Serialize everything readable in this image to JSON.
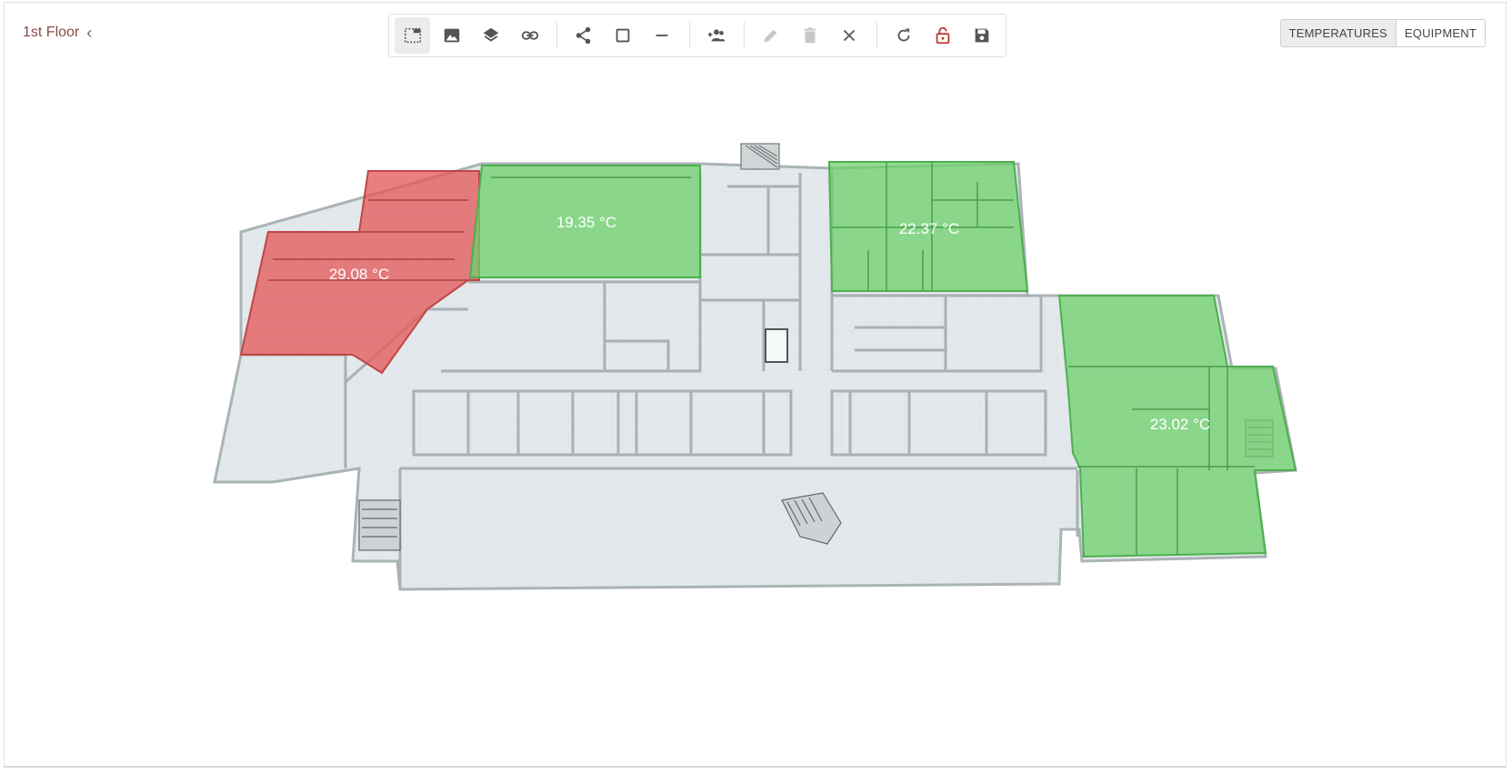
{
  "floor": {
    "title": "1st Floor",
    "back_icon": "chevron-left-icon"
  },
  "toolbar": {
    "buttons": [
      {
        "icon": "select-area-icon",
        "active": true,
        "enabled": true
      },
      {
        "icon": "image-icon",
        "active": false,
        "enabled": true
      },
      {
        "icon": "layers-icon",
        "active": false,
        "enabled": true
      },
      {
        "icon": "link-icon",
        "active": false,
        "enabled": true
      },
      {
        "icon": "share-icon",
        "active": false,
        "enabled": true
      },
      {
        "icon": "square-icon",
        "active": false,
        "enabled": true
      },
      {
        "icon": "line-icon",
        "active": false,
        "enabled": true
      },
      {
        "icon": "add-group-icon",
        "active": false,
        "enabled": true
      },
      {
        "icon": "edit-icon",
        "active": false,
        "enabled": false
      },
      {
        "icon": "delete-icon",
        "active": false,
        "enabled": false
      },
      {
        "icon": "close-icon",
        "active": false,
        "enabled": true
      },
      {
        "icon": "refresh-icon",
        "active": false,
        "enabled": true
      },
      {
        "icon": "unlock-icon",
        "active": false,
        "enabled": true
      },
      {
        "icon": "save-icon",
        "active": false,
        "enabled": true
      }
    ]
  },
  "view_toggle": {
    "temperatures": "TEMPERATURES",
    "equipment": "EQUIPMENT",
    "selected": "TEMPERATURES"
  },
  "zones": [
    {
      "label": "29.08 °C",
      "status": "hot",
      "color": "#e35b5b"
    },
    {
      "label": "19.35 °C",
      "status": "ok",
      "color": "#6cd26c"
    },
    {
      "label": "22.37 °C",
      "status": "ok",
      "color": "#6cd26c"
    },
    {
      "label": "23.02 °C",
      "status": "ok",
      "color": "#6cd26c"
    }
  ],
  "colors": {
    "hot": "#e35b5b",
    "ok": "#6cd26c",
    "floor": "#dfe6ea",
    "wall": "#b9c1c3"
  }
}
